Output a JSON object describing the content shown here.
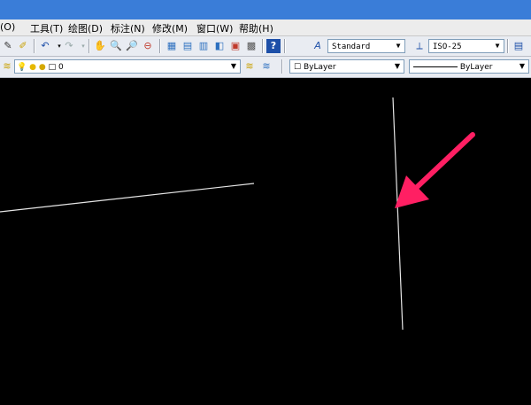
{
  "menu": {
    "items": [
      "(O)",
      "工具(T)",
      "绘图(D)",
      "标注(N)",
      "修改(M)",
      "窗口(W)",
      "帮助(H)"
    ]
  },
  "toolbar1": {
    "text_style": "Standard",
    "dim_style": "ISO-25"
  },
  "toolbar2": {
    "layer": "0",
    "color": "ByLayer",
    "linetype": "ByLayer"
  },
  "colors": {
    "canvas": "#000000",
    "line": "#e6e6e6",
    "arrow": "#ff1f63"
  }
}
